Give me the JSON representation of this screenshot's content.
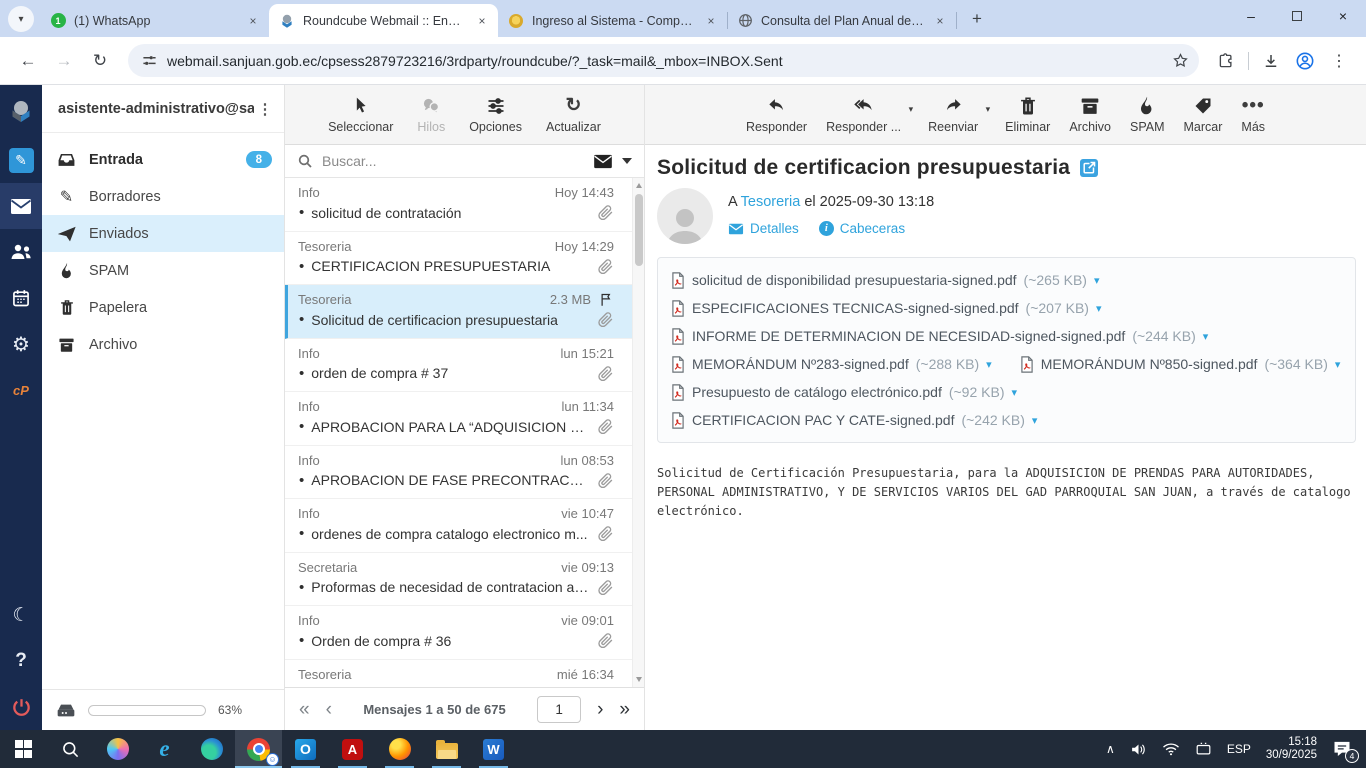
{
  "glyphs": {
    "bullet": "•",
    "caret_down": "▾",
    "refresh": "↻",
    "more_dots": "•••",
    "kebab": "⋮",
    "first": "«",
    "prev": "‹",
    "next": "›",
    "last": "»",
    "plus": "+",
    "minimize": "–",
    "close": "×",
    "moon": "☾",
    "gear": "⚙",
    "pencil": "✎",
    "help": "?",
    "cp_logo": "cP",
    "tray_chevron": "∧",
    "back": "←",
    "forward": "→",
    "whatsapp_badge": "1",
    "outlook_o": "O",
    "acrobat_a": "A",
    "word_w": "W",
    "ie_e": "e"
  },
  "browser": {
    "tabs": [
      {
        "title": "(1) WhatsApp"
      },
      {
        "title": "Roundcube Webmail :: Enviados"
      },
      {
        "title": "Ingreso al Sistema - Compras P"
      },
      {
        "title": "Consulta del Plan Anual de Con"
      }
    ],
    "url": "webmail.sanjuan.gob.ec/cpsess2879723216/3rdparty/roundcube/?_task=mail&_mbox=INBOX.Sent"
  },
  "sidebar": {
    "account": "asistente-administrativo@sa...",
    "folders": [
      {
        "label": "Entrada",
        "badge": "8"
      },
      {
        "label": "Borradores"
      },
      {
        "label": "Enviados"
      },
      {
        "label": "SPAM"
      },
      {
        "label": "Papelera"
      },
      {
        "label": "Archivo"
      }
    ],
    "storage_percent": "63%"
  },
  "list": {
    "toolbar": [
      "Seleccionar",
      "Hilos",
      "Opciones",
      "Actualizar"
    ],
    "search_placeholder": "Buscar...",
    "messages": [
      {
        "sender": "Info",
        "meta": "Hoy 14:43",
        "subject": "solicitud de contratación"
      },
      {
        "sender": "Tesoreria",
        "meta": "Hoy 14:29",
        "subject": "CERTIFICACION PRESUPUESTARIA"
      },
      {
        "sender": "Tesoreria",
        "meta": "2.3 MB",
        "subject": "Solicitud de certificacion presupuestaria"
      },
      {
        "sender": "Info",
        "meta": "lun 15:21",
        "subject": "orden de compra # 37"
      },
      {
        "sender": "Info",
        "meta": "lun 11:34",
        "subject": "APROBACION PARA LA “ADQUISICION DE B..."
      },
      {
        "sender": "Info",
        "meta": "lun 08:53",
        "subject": "APROBACION DE FASE PRECONTRACTUAL ..."
      },
      {
        "sender": "Info",
        "meta": "vie 10:47",
        "subject": "ordenes de compra catalogo electronico m..."
      },
      {
        "sender": "Secretaria",
        "meta": "vie 09:13",
        "subject": "Proformas de necesidad de contratacion ad..."
      },
      {
        "sender": "Info",
        "meta": "vie 09:01",
        "subject": "Orden de compra # 36"
      },
      {
        "sender": "Tesoreria",
        "meta": "mié 16:34",
        "subject": ""
      }
    ],
    "pagination": "Mensajes 1 a 50 de 675",
    "page": "1"
  },
  "message": {
    "toolbar": [
      "Responder",
      "Responder ...",
      "Reenviar",
      "Eliminar",
      "Archivo",
      "SPAM",
      "Marcar",
      "Más"
    ],
    "subject": "Solicitud de certificacion presupuestaria",
    "to_prefix": "A",
    "to": "Tesoreria",
    "date_text": "el 2025-09-30 13:18",
    "details_label": "Detalles",
    "headers_label": "Cabeceras",
    "attachments": [
      {
        "name": "solicitud de disponibilidad presupuestaria-signed.pdf",
        "size": "(~265 KB)"
      },
      {
        "name": "ESPECIFICACIONES TECNICAS-signed-signed.pdf",
        "size": "(~207 KB)"
      },
      {
        "name": "INFORME DE DETERMINACION DE NECESIDAD-signed-signed.pdf",
        "size": "(~244 KB)"
      },
      {
        "name": "MEMORÁNDUM Nº283-signed.pdf",
        "size": "(~288 KB)"
      },
      {
        "name": "MEMORÁNDUM Nº850-signed.pdf",
        "size": "(~364 KB)"
      },
      {
        "name": "Presupuesto de catálogo electrónico.pdf",
        "size": "(~92 KB)"
      },
      {
        "name": "CERTIFICACION PAC Y CATE-signed.pdf",
        "size": "(~242 KB)"
      }
    ],
    "body_lines": [
      "Solicitud de Certificación Presupuestaria, para la ADQUISICION DE PRENDAS PARA AUTORIDADES,",
      "PERSONAL ADMINISTRATIVO, Y DE SERVICIOS VARIOS DEL GAD PARROQUIAL SAN JUAN, a través de catalogo",
      "electrónico."
    ]
  },
  "taskbar": {
    "lang": "ESP",
    "time": "15:18",
    "date": "30/9/2025",
    "notif_badge": "4"
  }
}
